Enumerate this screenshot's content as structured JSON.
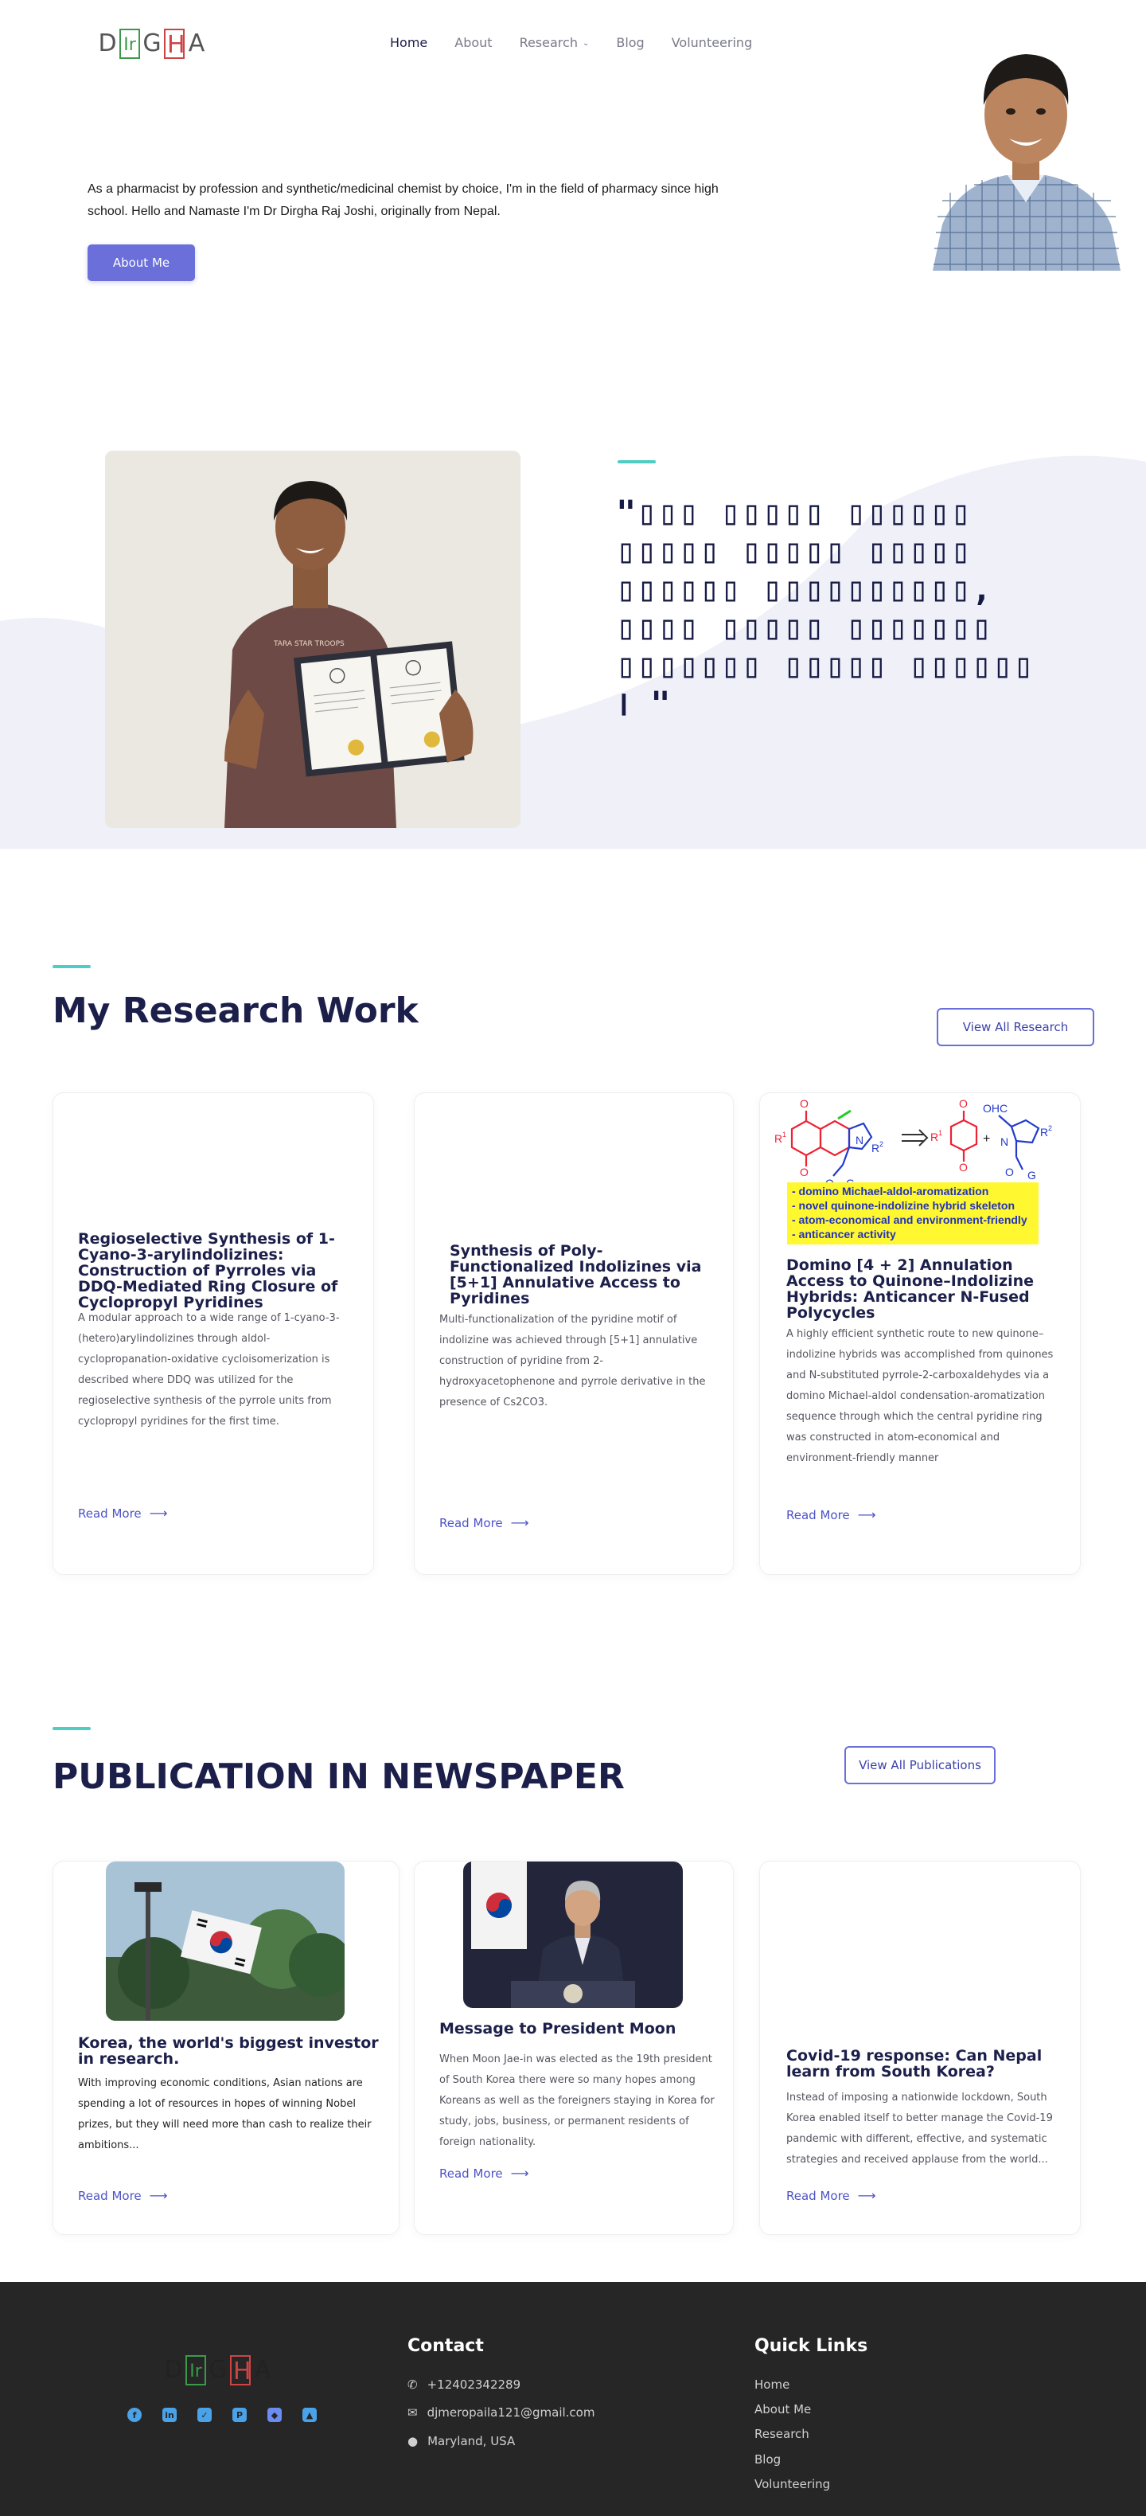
{
  "header": {
    "logo": [
      {
        "letter": "D",
        "frame": ""
      },
      {
        "letter": "Ir",
        "frame": "#3a9a4a"
      },
      {
        "letter": "G",
        "frame": ""
      },
      {
        "letter": "H",
        "frame": "#c44"
      },
      {
        "letter": "A",
        "frame": ""
      }
    ],
    "nav": {
      "home": "Home",
      "about": "About",
      "research": "Research",
      "blog": "Blog",
      "volunteering": "Volunteering"
    }
  },
  "hero": {
    "intro": "As a pharmacist by profession and synthetic/medicinal chemist by choice, I'm in the field of pharmacy since high school. Hello and Namaste  I'm Dr Dirgha Raj Joshi, originally from Nepal.",
    "button": "About Me"
  },
  "quote": {
    "text": "\"▯▯▯ ▯▯▯▯▯ ▯▯▯▯▯▯ ▯▯▯▯▯ ▯▯▯▯▯ ▯▯▯▯▯ ▯▯▯▯▯▯ ▯▯▯▯▯▯▯▯▯▯, ▯▯▯▯ ▯▯▯▯▯ ▯▯▯▯▯▯▯ ▯▯▯▯▯▯▯ ▯▯▯▯▯ ▯▯▯▯▯▯ । \""
  },
  "research": {
    "title": "My Research Work",
    "view_all": "View All Research",
    "cards": [
      {
        "title": "Regioselective Synthesis of 1-Cyano-3-arylindolizines: Construction of Pyrroles via DDQ-Mediated Ring Closure of Cyclopropyl Pyridines",
        "desc": "A modular approach to a wide range of 1-cyano-3-(hetero)arylindolizines through aldol-cyclopropanation-oxidative cycloisomerization is described where DDQ was utilized for the regioselective synthesis of the pyrrole units from cyclopropyl pyridines for the first time.",
        "link": "Read More"
      },
      {
        "title": "Synthesis of Poly-Functionalized Indolizines via [5+1] Annulative Access to Pyridines",
        "desc": "Multi-functionalization of the pyridine motif of indolizine was achieved through [5+1] annulative construction of pyridine from 2-hydroxyacetophenone and pyrrole derivative in the presence of Cs2CO3.",
        "link": "Read More"
      },
      {
        "title": "Domino [4 + 2] Annulation Access to Quinone–Indolizine Hybrids: Anticancer N-Fused Polycycles",
        "desc": "A highly efficient synthetic route to new quinone–indolizine hybrids was accomplished from quinones and N-substituted pyrrole-2-carboxaldehydes via a domino Michael-aldol condensation-aromatization sequence through which the central pyridine ring was constructed in atom-economical and environment-friendly manner",
        "link": "Read More",
        "graphic_labels": {
          "bullets": [
            "- domino Michael-aldol-aromatization",
            "- novel quinone-indolizine hybrid skeleton",
            "- atom-economical and environment-friendly",
            "- anticancer activity"
          ],
          "ohc": "OHC",
          "r1": "R",
          "r2": "R",
          "sup1": "1",
          "sup2": "2",
          "o": "O",
          "n": "N",
          "g": "G"
        }
      }
    ]
  },
  "news": {
    "title": "PUBLICATION IN NEWSPAPER",
    "view_all": "View All Publications",
    "cards": [
      {
        "title": "Korea, the world's biggest investor in research.",
        "desc": "With improving economic conditions, Asian nations are spending a lot of resources in hopes of winning Nobel prizes, but they will need more than cash to realize their ambitions...",
        "link": "Read More"
      },
      {
        "title": "Message to President Moon",
        "desc": "When Moon Jae-in was elected as the 19th president of South Korea there were so many hopes among Koreans as well as the foreigners staying in Korea for study, jobs, business, or permanent residents of foreign nationality.",
        "link": "Read More"
      },
      {
        "title": "Covid-19 response: Can Nepal learn from South Korea?",
        "desc": "Instead of imposing a nationwide lockdown, South Korea enabled itself to better manage the Covid-19 pandemic with different, effective, and systematic strategies and received applause from the world...",
        "link": "Read More"
      }
    ]
  },
  "footer": {
    "social": [
      "f",
      "in",
      "✓",
      "P",
      "◆",
      "▲"
    ],
    "contact": {
      "title": "Contact",
      "phone": "+12402342289",
      "email": "djmeropaila121@gmail.com",
      "location": "Maryland, USA"
    },
    "quick_links": {
      "title": "Quick Links",
      "items": [
        "Home",
        "About Me",
        "Research",
        "Blog",
        "Volunteering"
      ]
    }
  },
  "colors": {
    "accent": "#4ecdc4",
    "primary": "#6a6fd9",
    "heading": "#1c1f4a",
    "link": "#4c53c7",
    "footer_bg": "#262626"
  }
}
